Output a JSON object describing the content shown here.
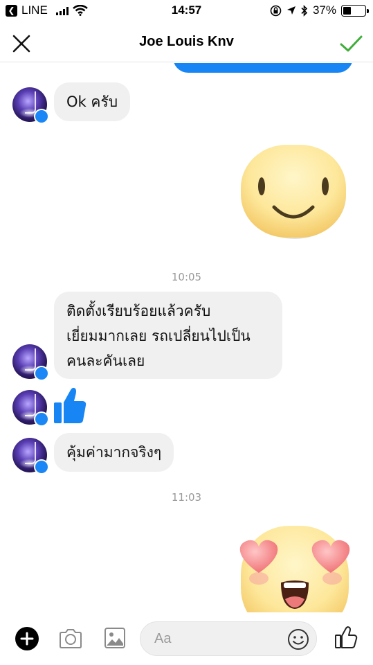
{
  "status_bar": {
    "app_back_label": "LINE",
    "time": "14:57",
    "battery_percent": "37%",
    "battery_level": 0.37
  },
  "header": {
    "title": "Joe Louis Knv"
  },
  "messages": [
    {
      "text": "Ok ครับ"
    },
    {
      "timestamp": "10:05"
    },
    {
      "text_lines": [
        "ติดตั้งเรียบร้อยแล้วครับ",
        "เยี่ยมมากเลย รถเปลี่ยนไปเป็น",
        "คนละคันเลย"
      ]
    },
    {
      "text": "คุ้มค่ามากจริงๆ"
    },
    {
      "timestamp": "11:03"
    }
  ],
  "composer": {
    "placeholder": "Aa"
  },
  "colors": {
    "accent_blue": "#1785f3",
    "confirm_green": "#3fae3a",
    "bubble_grey": "#f1f0f0"
  },
  "icons": [
    "close-icon",
    "checkmark-icon",
    "messenger-badge-icon",
    "thumbs-up-icon",
    "plus-icon",
    "camera-icon",
    "gallery-icon",
    "emoji-icon",
    "like-icon",
    "wifi-icon",
    "bluetooth-icon",
    "location-icon",
    "rotation-lock-icon",
    "battery-icon"
  ]
}
